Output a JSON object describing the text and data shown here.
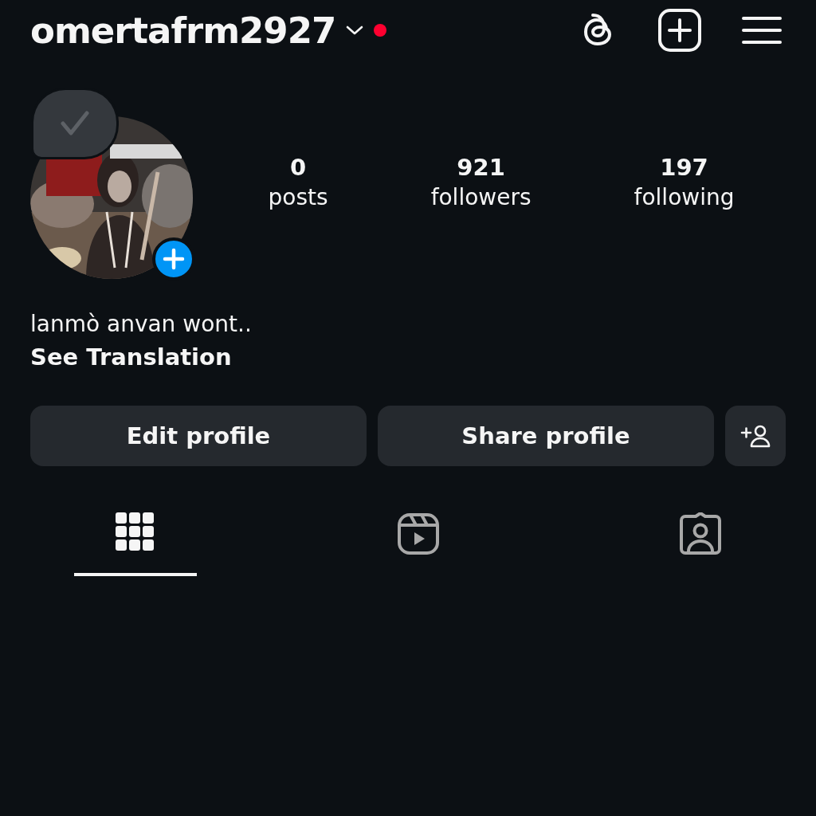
{
  "header": {
    "username": "omertafrm2927",
    "has_notification": true
  },
  "profile": {
    "has_note": true,
    "stats": [
      {
        "count": "0",
        "label": "posts"
      },
      {
        "count": "921",
        "label": "followers"
      },
      {
        "count": "197",
        "label": "following"
      }
    ],
    "bio": "lanmò anvan wont..",
    "translate_link": "See Translation"
  },
  "buttons": [
    {
      "label": "Edit profile"
    },
    {
      "label": "Share profile"
    }
  ],
  "tabs": [
    {
      "kind": "grid",
      "selected": true
    },
    {
      "kind": "reels",
      "selected": false
    },
    {
      "kind": "tagged",
      "selected": false
    }
  ]
}
